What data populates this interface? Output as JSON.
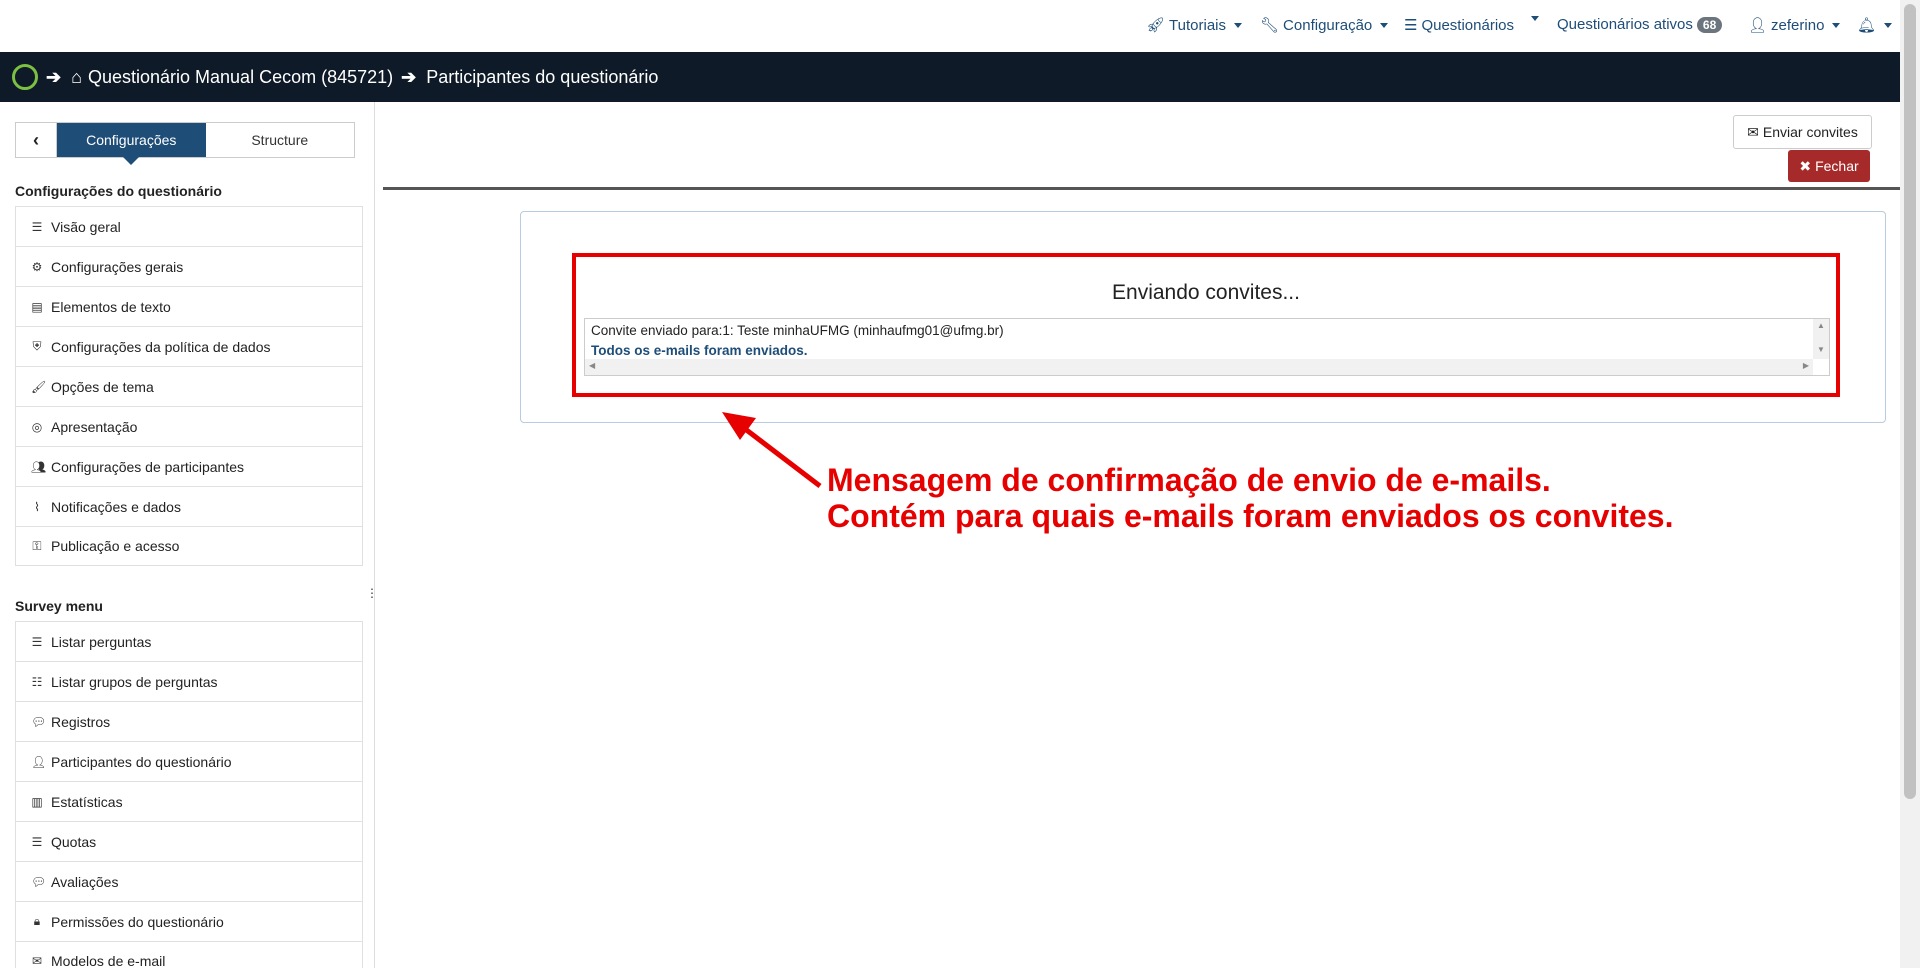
{
  "topnav": {
    "tutoriais": "Tutoriais",
    "configuracao": "Configuração",
    "questionarios": "Questionários",
    "ativos_label": "Questionários ativos",
    "ativos_count": "68",
    "user": "zeferino"
  },
  "breadcrumb": {
    "survey": "Questionário Manual Cecom (845721)",
    "page": "Participantes do questionário"
  },
  "sidebar": {
    "tab_config": "Configurações",
    "tab_structure": "Structure",
    "section1_title": "Configurações do questionário",
    "section1_items": [
      {
        "label": "Visão geral",
        "icon": "list-icon"
      },
      {
        "label": "Configurações gerais",
        "icon": "gears-icon"
      },
      {
        "label": "Elementos de texto",
        "icon": "file-text-icon"
      },
      {
        "label": "Configurações da política de dados",
        "icon": "shield-icon"
      },
      {
        "label": "Opções de tema",
        "icon": "paintbrush-icon"
      },
      {
        "label": "Apresentação",
        "icon": "eye-slash-icon"
      },
      {
        "label": "Configurações de participantes",
        "icon": "users-icon"
      },
      {
        "label": "Notificações e dados",
        "icon": "rss-icon"
      },
      {
        "label": "Publicação e acesso",
        "icon": "key-icon"
      }
    ],
    "section2_title": "Survey menu",
    "section2_items": [
      {
        "label": "Listar perguntas",
        "icon": "list-icon"
      },
      {
        "label": "Listar grupos de perguntas",
        "icon": "th-list-icon"
      },
      {
        "label": "Registros",
        "icon": "comment-icon"
      },
      {
        "label": "Participantes do questionário",
        "icon": "user-icon"
      },
      {
        "label": "Estatísticas",
        "icon": "bar-chart-icon"
      },
      {
        "label": "Quotas",
        "icon": "tasks-icon"
      },
      {
        "label": "Avaliações",
        "icon": "comment-icon"
      },
      {
        "label": "Permissões do questionário",
        "icon": "lock-icon"
      },
      {
        "label": "Modelos de e-mail",
        "icon": "envelope-icon"
      }
    ]
  },
  "toolbar": {
    "send_invites": "Enviar convites",
    "close": "Fechar"
  },
  "sending": {
    "title": "Enviando convites...",
    "line1": "Convite enviado para:1: Teste minhaUFMG (minhaufmg01@ufmg.br)",
    "line2": "Todos os e-mails foram enviados."
  },
  "annotation": {
    "line1": "Mensagem de confirmação de envio de e-mails.",
    "line2": "Contém para quais e-mails foram enviados os convites."
  },
  "colors": {
    "brand_dark": "#0e1a27",
    "primary": "#1e4d78",
    "danger": "#a72a2a",
    "annotation": "#e60000"
  }
}
